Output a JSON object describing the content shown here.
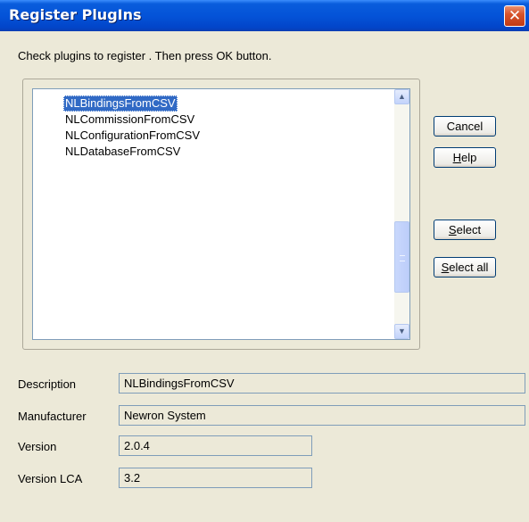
{
  "window": {
    "title": "Register PlugIns",
    "close_glyph": "✕"
  },
  "instructions": "Check plugins to register . Then press OK button.",
  "plugins": [
    {
      "label": "NLBindingsFromCSV",
      "selected": true
    },
    {
      "label": "NLCommissionFromCSV",
      "selected": false
    },
    {
      "label": "NLConfigurationFromCSV",
      "selected": false
    },
    {
      "label": "NLDatabaseFromCSV",
      "selected": false
    }
  ],
  "scrollbar": {
    "up_glyph": "▲",
    "down_glyph": "▼"
  },
  "buttons": {
    "cancel": {
      "label": "Cancel"
    },
    "help": {
      "accel": "H",
      "rest": "elp"
    },
    "select": {
      "accel": "S",
      "rest": "elect"
    },
    "select_all": {
      "accel": "S",
      "rest": "elect all"
    }
  },
  "details": {
    "description": {
      "label": "Description",
      "value": "NLBindingsFromCSV"
    },
    "manufacturer": {
      "label": "Manufacturer",
      "value": "Newron System"
    },
    "version": {
      "label": "Version",
      "value": "2.0.4"
    },
    "version_lca": {
      "label": "Version LCA",
      "value": "3.2"
    }
  }
}
